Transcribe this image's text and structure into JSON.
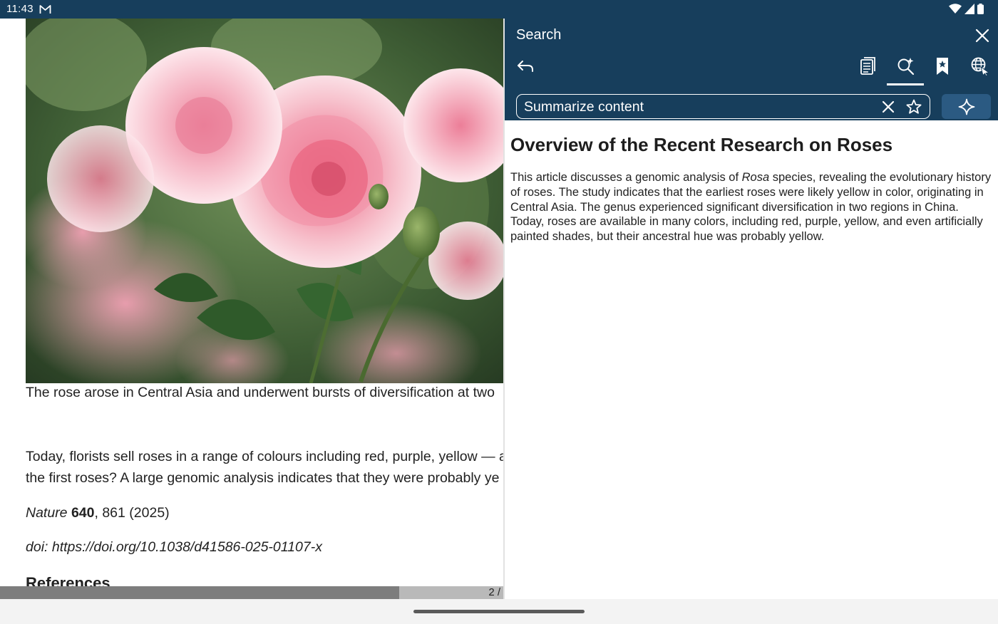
{
  "status_bar": {
    "time": "11:43",
    "notification_icon": "gmail-icon",
    "icons": [
      "wifi-icon",
      "signal-icon",
      "battery-icon"
    ]
  },
  "reader": {
    "image_alt": "pink roses photo",
    "caption": "The rose arose in Central Asia and underwent bursts of diversification at two",
    "para_line1": "Today, florists sell roses in a range of colours including red, purple, yellow — a",
    "para_line2": "the first roses? A large genomic analysis indicates that they were probably ye",
    "citation": {
      "journal": "Nature",
      "volume": "640",
      "rest": ", 861 (2025)"
    },
    "doi": "doi: https://doi.org/10.1038/d41586-025-01107-x",
    "references_heading": "References",
    "page_indicator": "2 /",
    "progress_fraction": 0.793
  },
  "search_panel": {
    "title": "Search",
    "tabs": [
      {
        "name": "tab-document",
        "icon": "document-icon",
        "active": false
      },
      {
        "name": "tab-ai-search",
        "icon": "sparkle-search-icon",
        "active": true
      },
      {
        "name": "tab-bookmarks",
        "icon": "bookmark-star-icon",
        "active": false
      },
      {
        "name": "tab-web-translate",
        "icon": "globe-translate-icon",
        "active": false
      }
    ],
    "query": "Summarize content",
    "result_title": "Overview of the Recent Research on Roses",
    "result_body_pre": "This article discusses a genomic analysis of ",
    "result_body_italic": "Rosa",
    "result_body_post": " species, revealing the evolutionary history of roses. The study indicates that the earliest roses were likely yellow in color, originating in Central Asia. The genus experienced significant diversification in two regions in China. Today, roses are available in many colors, including red, purple, yellow, and even artificially painted shades, but their ancestral hue was probably yellow."
  },
  "colors": {
    "header": "#173e5c",
    "ai_button": "#2b5a82",
    "text": "#222222"
  }
}
